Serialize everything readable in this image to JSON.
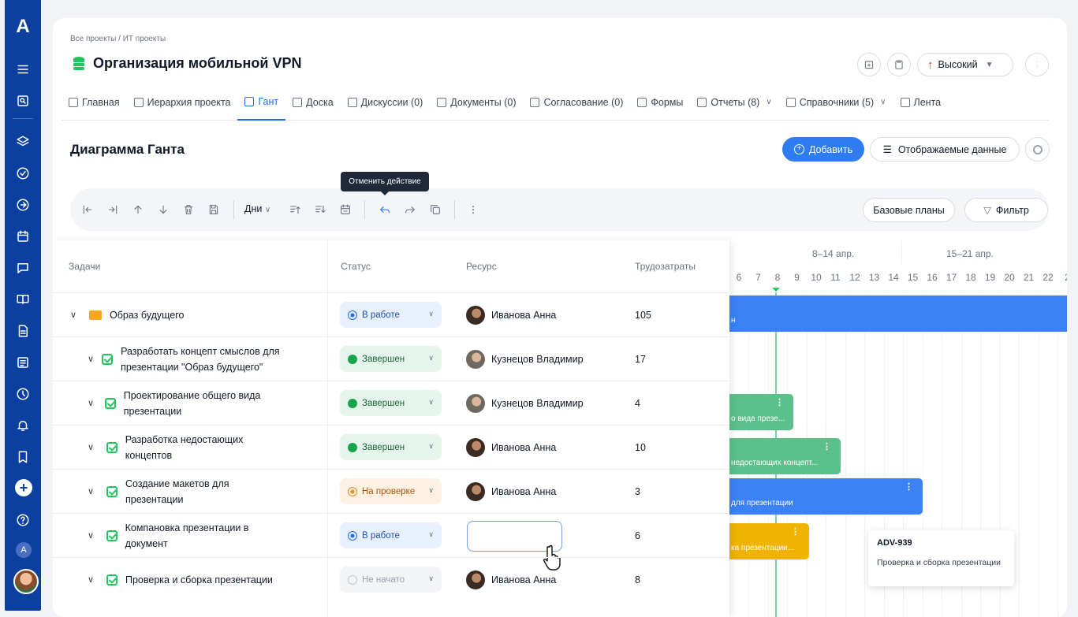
{
  "app": {
    "logo": "A",
    "plus": "+",
    "mini": "A"
  },
  "breadcrumb": "Все проекты  /  ИТ проекты",
  "project_title": "Организация мобильной VPN",
  "priority": {
    "label": "Высокий",
    "arrow": "↑",
    "color": "#dc2626"
  },
  "tabs": [
    {
      "label": "Главная",
      "icon": "home-icon"
    },
    {
      "label": "Иерархия проекта",
      "icon": "folder-icon"
    },
    {
      "label": "Гант",
      "icon": "gantt-icon",
      "active": true
    },
    {
      "label": "Доска",
      "icon": "board-icon"
    },
    {
      "label": "Дискуссии (0)",
      "icon": "chat-icon"
    },
    {
      "label": "Документы (0)",
      "icon": "doc-icon"
    },
    {
      "label": "Согласование (0)",
      "icon": "book-icon"
    },
    {
      "label": "Формы",
      "icon": "form-icon"
    },
    {
      "label": "Отчеты (8)",
      "icon": "report-icon",
      "dropdown": true
    },
    {
      "label": "Справочники (5)",
      "icon": "catalog-icon",
      "dropdown": true
    },
    {
      "label": "Лента",
      "icon": "feed-icon"
    }
  ],
  "section_title": "Диаграмма Ганта",
  "buttons": {
    "add": "Добавить",
    "display": "Отображаемые данные",
    "baselines": "Базовые планы",
    "filter": "Фильтр",
    "scale": "Дни"
  },
  "tooltip": "Отменить действие",
  "grid": {
    "headers": {
      "tasks": "Задачи",
      "status": "Статус",
      "resource": "Ресурс",
      "effort": "Трудозатраты"
    },
    "rows": [
      {
        "name": "Образ будущего",
        "type": "folder",
        "status": "В работе",
        "status_kind": "work",
        "resource": "Иванова Анна",
        "effort": "105"
      },
      {
        "name": "Разработать концепт смыслов для презентации \"Образ будущего\"",
        "type": "task",
        "status": "Завершен",
        "status_kind": "done",
        "resource": "Кузнецов Владимир",
        "effort": "17"
      },
      {
        "name": "Проектирование общего вида презентации",
        "type": "task",
        "status": "Завершен",
        "status_kind": "done",
        "resource": "Кузнецов Владимир",
        "effort": "4"
      },
      {
        "name": "Разработка недостающих концептов",
        "type": "task",
        "status": "Завершен",
        "status_kind": "done",
        "resource": "Иванова Анна",
        "effort": "10"
      },
      {
        "name": "Создание макетов для презентации",
        "type": "task",
        "status": "На проверке",
        "status_kind": "rev",
        "resource": "Иванова Анна",
        "effort": "3"
      },
      {
        "name": "Компановка презентации в документ",
        "type": "task",
        "status": "В работе",
        "status_kind": "work",
        "resource": "",
        "effort": "6"
      },
      {
        "name": "Проверка и сборка презентации",
        "type": "task",
        "status": "Не начато",
        "status_kind": "none",
        "resource": "Иванова Анна",
        "effort": "8"
      }
    ]
  },
  "gantt": {
    "weeks": [
      "8–14 апр.",
      "15–21 апр."
    ],
    "days": [
      "6",
      "7",
      "8",
      "9",
      "10",
      "11",
      "12",
      "13",
      "14",
      "15",
      "16",
      "17",
      "18",
      "19",
      "20",
      "21",
      "22",
      "2"
    ],
    "bars": [
      {
        "label": "н",
        "color": "#3b82f6"
      },
      {
        "label": "о вида презе...",
        "color": "#5cc08a"
      },
      {
        "label": "недостающих концепт...",
        "color": "#5cc08a"
      },
      {
        "label": "для презентации",
        "color": "#3b82f6"
      },
      {
        "label": "ка презентации...",
        "color": "#f0b400"
      }
    ],
    "popup": {
      "key": "ADV-939",
      "text": "Проверка и сборка презентации"
    }
  }
}
